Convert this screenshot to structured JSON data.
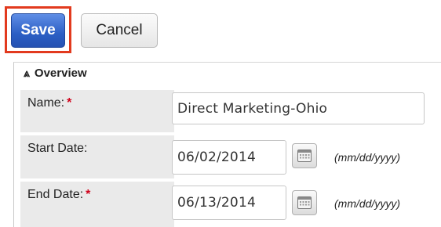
{
  "toolbar": {
    "save_label": "Save",
    "cancel_label": "Cancel"
  },
  "panel": {
    "header": "Overview",
    "collapse_icon": "double-chevron-up-icon"
  },
  "fields": {
    "name": {
      "label": "Name:",
      "required": "*",
      "value": "Direct Marketing-Ohio"
    },
    "start_date": {
      "label": "Start Date:",
      "value": "06/02/2014",
      "format": "(mm/dd/yyyy)",
      "icon": "calendar-icon"
    },
    "end_date": {
      "label": "End Date:",
      "required": "*",
      "value": "06/13/2014",
      "format": "(mm/dd/yyyy)",
      "icon": "calendar-icon"
    }
  },
  "colors": {
    "save_button": "#2c5fc4",
    "highlight_border": "#e23a1e",
    "required_marker": "#d0021b",
    "label_background": "#eaeaea"
  }
}
